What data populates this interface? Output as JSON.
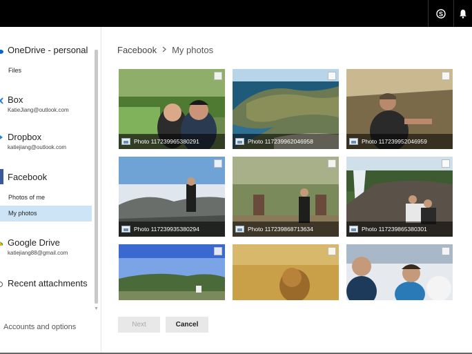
{
  "topbar": {
    "icons": [
      "skype-icon",
      "bell-icon"
    ]
  },
  "sidebar": {
    "providers": [
      {
        "name": "OneDrive - personal",
        "sub": "",
        "icon": "onedrive-icon",
        "color": "#0a64c8"
      },
      {
        "name": "Box",
        "sub": "KatieJiang@outlook.com",
        "icon": "box-icon",
        "color": "#2a7fd4"
      },
      {
        "name": "Dropbox",
        "sub": "katiejiang@outlook.com",
        "icon": "dropbox-icon",
        "color": "#2a7fd4"
      },
      {
        "name": "Facebook",
        "sub": "",
        "icon": "facebook-icon",
        "color": "#3b5998"
      },
      {
        "name": "Google Drive",
        "sub": "katiejiang88@gmail.com",
        "icon": "google-drive-icon",
        "color": "#f4b400"
      },
      {
        "name": "Recent attachments",
        "sub": "",
        "icon": "clock-icon",
        "color": "#555555"
      }
    ],
    "onedrive_sub": "Files",
    "facebook_subs": [
      "Photos of me",
      "My photos"
    ],
    "accounts": "Accounts and options"
  },
  "breadcrumb": {
    "root": "Facebook",
    "separator": ">",
    "current": "My photos"
  },
  "photos": [
    {
      "caption": "Photo 117239965380291"
    },
    {
      "caption": "Photo 117239962046958"
    },
    {
      "caption": "Photo 117239952046959"
    },
    {
      "caption": "Photo 117239935380294"
    },
    {
      "caption": "Photo 117239868713634"
    },
    {
      "caption": "Photo 117239865380301"
    },
    {
      "caption": ""
    },
    {
      "caption": ""
    },
    {
      "caption": ""
    }
  ],
  "buttons": {
    "next": "Next",
    "cancel": "Cancel"
  },
  "colors": {
    "selected_bg": "#cde4f7",
    "facebook": "#3b5998",
    "topbar": "#000000"
  }
}
